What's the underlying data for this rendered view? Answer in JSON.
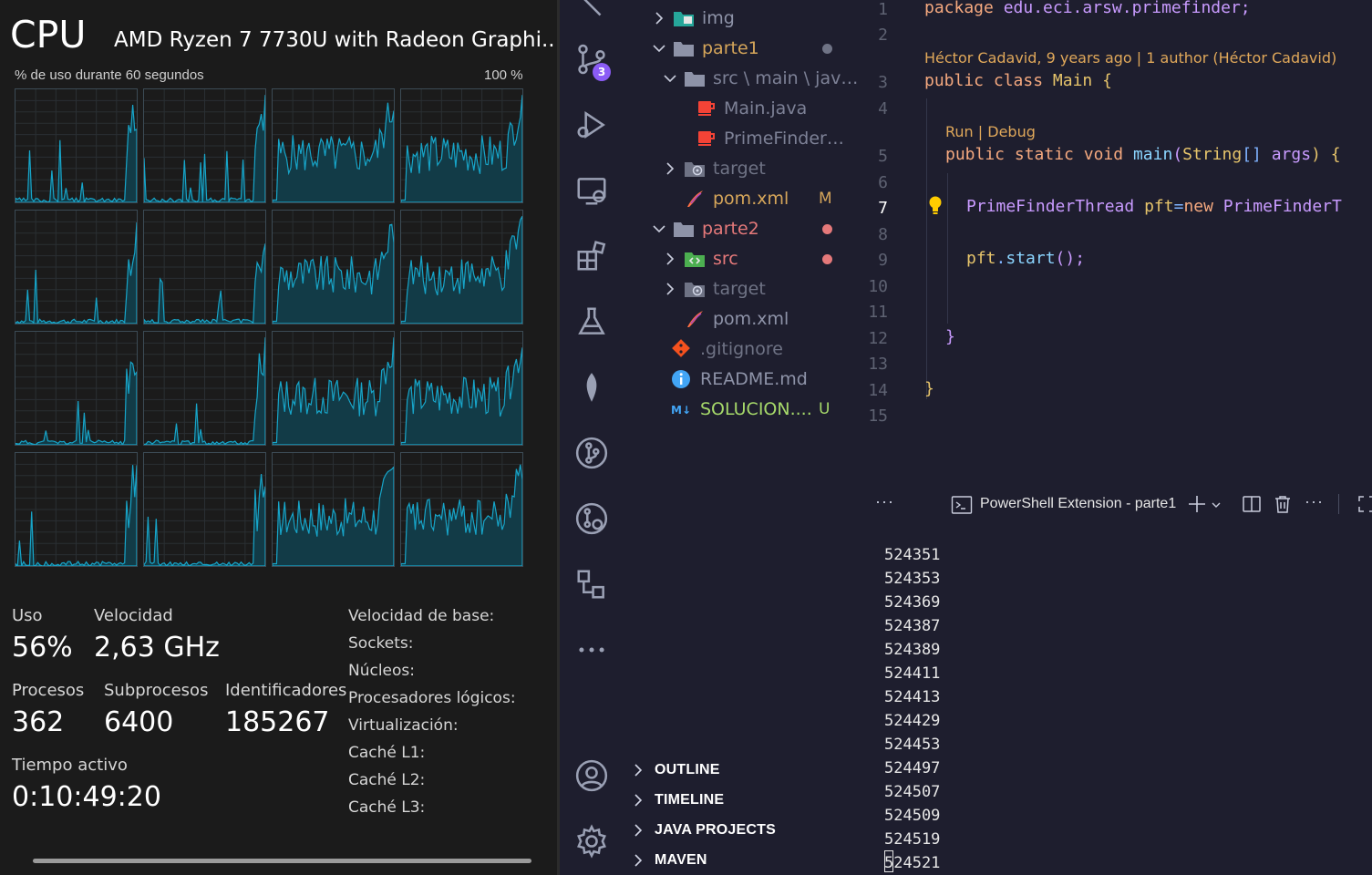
{
  "task_manager": {
    "title": "CPU",
    "cpu_name": "AMD Ryzen 7 7730U with Radeon Graphi...",
    "usage_graph_label": "% de uso durante 60 segundos",
    "usage_graph_max": "100 %",
    "stats": {
      "uso_label": "Uso",
      "uso_value": "56%",
      "velocidad_label": "Velocidad",
      "velocidad_value": "2,63 GHz",
      "procesos_label": "Procesos",
      "procesos_value": "362",
      "subprocesos_label": "Subprocesos",
      "subprocesos_value": "6400",
      "identificadores_label": "Identificadores",
      "identificadores_value": "185267",
      "tiempo_label": "Tiempo activo",
      "tiempo_value": "0:10:49:20"
    },
    "specs": [
      "Velocidad de base:",
      "Sockets:",
      "Núcleos:",
      "Procesadores lógicos:",
      "Virtualización:",
      "Caché L1:",
      "Caché L2:",
      "Caché L3:"
    ],
    "core_count": 16,
    "graph_colors": {
      "stroke": "#17a5c9",
      "fill": "#123b47"
    }
  },
  "vscode": {
    "activity_bar": {
      "scm_badge": "3",
      "icons": [
        "explorer-icon",
        "source-control-icon",
        "run-debug-icon",
        "remote-explorer-icon",
        "extensions-icon",
        "testing-icon",
        "mongodb-icon",
        "git-graph-icon",
        "github-icon",
        "diagram-icon",
        "more-icon",
        "account-icon",
        "settings-gear-icon"
      ]
    },
    "explorer": {
      "items": [
        {
          "label": "img",
          "kind": "folder-img",
          "indent": 1,
          "chevron": "right",
          "color": "#8e93a8",
          "status": ""
        },
        {
          "label": "parte1",
          "kind": "folder",
          "indent": 1,
          "chevron": "down",
          "color": "#d6a65a",
          "status": "dot-gray"
        },
        {
          "label": "src \\ main \\ java \\ ...",
          "kind": "folder",
          "indent": 2,
          "chevron": "down",
          "color": "#7d8196",
          "status": ""
        },
        {
          "label": "Main.java",
          "kind": "java",
          "indent": 3,
          "chevron": "",
          "color": "#7d8196",
          "status": ""
        },
        {
          "label": "PrimeFinderThr...",
          "kind": "java",
          "indent": 3,
          "chevron": "",
          "color": "#7d8196",
          "status": ""
        },
        {
          "label": "target",
          "kind": "folder-target",
          "indent": 2,
          "chevron": "right",
          "color": "#6f7385",
          "status": ""
        },
        {
          "label": "pom.xml",
          "kind": "xml",
          "indent": 2,
          "chevron": "",
          "color": "#d6a65a",
          "status": "M"
        },
        {
          "label": "parte2",
          "kind": "folder",
          "indent": 1,
          "chevron": "down",
          "color": "#e5797a",
          "status": "dot-red"
        },
        {
          "label": "src",
          "kind": "folder-src",
          "indent": 2,
          "chevron": "right",
          "color": "#e5797a",
          "status": "dot-red"
        },
        {
          "label": "target",
          "kind": "folder-target",
          "indent": 2,
          "chevron": "right",
          "color": "#6f7385",
          "status": ""
        },
        {
          "label": "pom.xml",
          "kind": "xml",
          "indent": 2,
          "chevron": "",
          "color": "#8e93a8",
          "status": ""
        },
        {
          "label": ".gitignore",
          "kind": "git",
          "indent": 1,
          "chevron": "",
          "color": "#6f7385",
          "status": ""
        },
        {
          "label": "README.md",
          "kind": "info",
          "indent": 1,
          "chevron": "",
          "color": "#8e93a8",
          "status": ""
        },
        {
          "label": "SOLUCION....",
          "kind": "markdown",
          "indent": 1,
          "chevron": "",
          "color": "#a6d96a",
          "status": "U"
        }
      ],
      "sections": [
        "OUTLINE",
        "TIMELINE",
        "JAVA PROJECTS",
        "MAVEN"
      ]
    },
    "editor": {
      "line_numbers": [
        "1",
        "2",
        "3",
        "4",
        "5",
        "6",
        "7",
        "8",
        "9",
        "10",
        "11",
        "12",
        "13",
        "14",
        "15"
      ],
      "active_line": "7",
      "blame": "Héctor Cadavid, 9 years ago | 1 author (Héctor Cadavid)",
      "codelens": "Run | Debug",
      "code": {
        "l1_kw": "package",
        "l1_rest": "edu.eci.arsw.primefinder;",
        "l3_kw1": "public",
        "l3_kw2": "class",
        "l3_name": "Main",
        "l3_brace": "{",
        "l5_kw1": "public",
        "l5_kw2": "static",
        "l5_kw3": "void",
        "l5_fn": "main",
        "l5_paren": "(",
        "l5_type": "String",
        "l5_arr": "[]",
        "l5_arg": "args",
        "l5_end": ") {",
        "l7_type": "PrimeFinderThread",
        "l7_var": "pft",
        "l7_eq": "=",
        "l7_new": "new",
        "l7_ctor": "PrimeFinderT",
        "l9_var": "pft",
        "l9_dot": ".",
        "l9_fn": "start",
        "l9_end": "();",
        "l12_brace": "}",
        "l14_brace": "}"
      }
    },
    "terminal": {
      "more_label": "···",
      "tab_label": "PowerShell Extension - parte1",
      "output": [
        "524351",
        "524353",
        "524369",
        "524387",
        "524389",
        "524411",
        "524413",
        "524429",
        "524453",
        "524497",
        "524507",
        "524509",
        "524519",
        "524521"
      ]
    }
  }
}
